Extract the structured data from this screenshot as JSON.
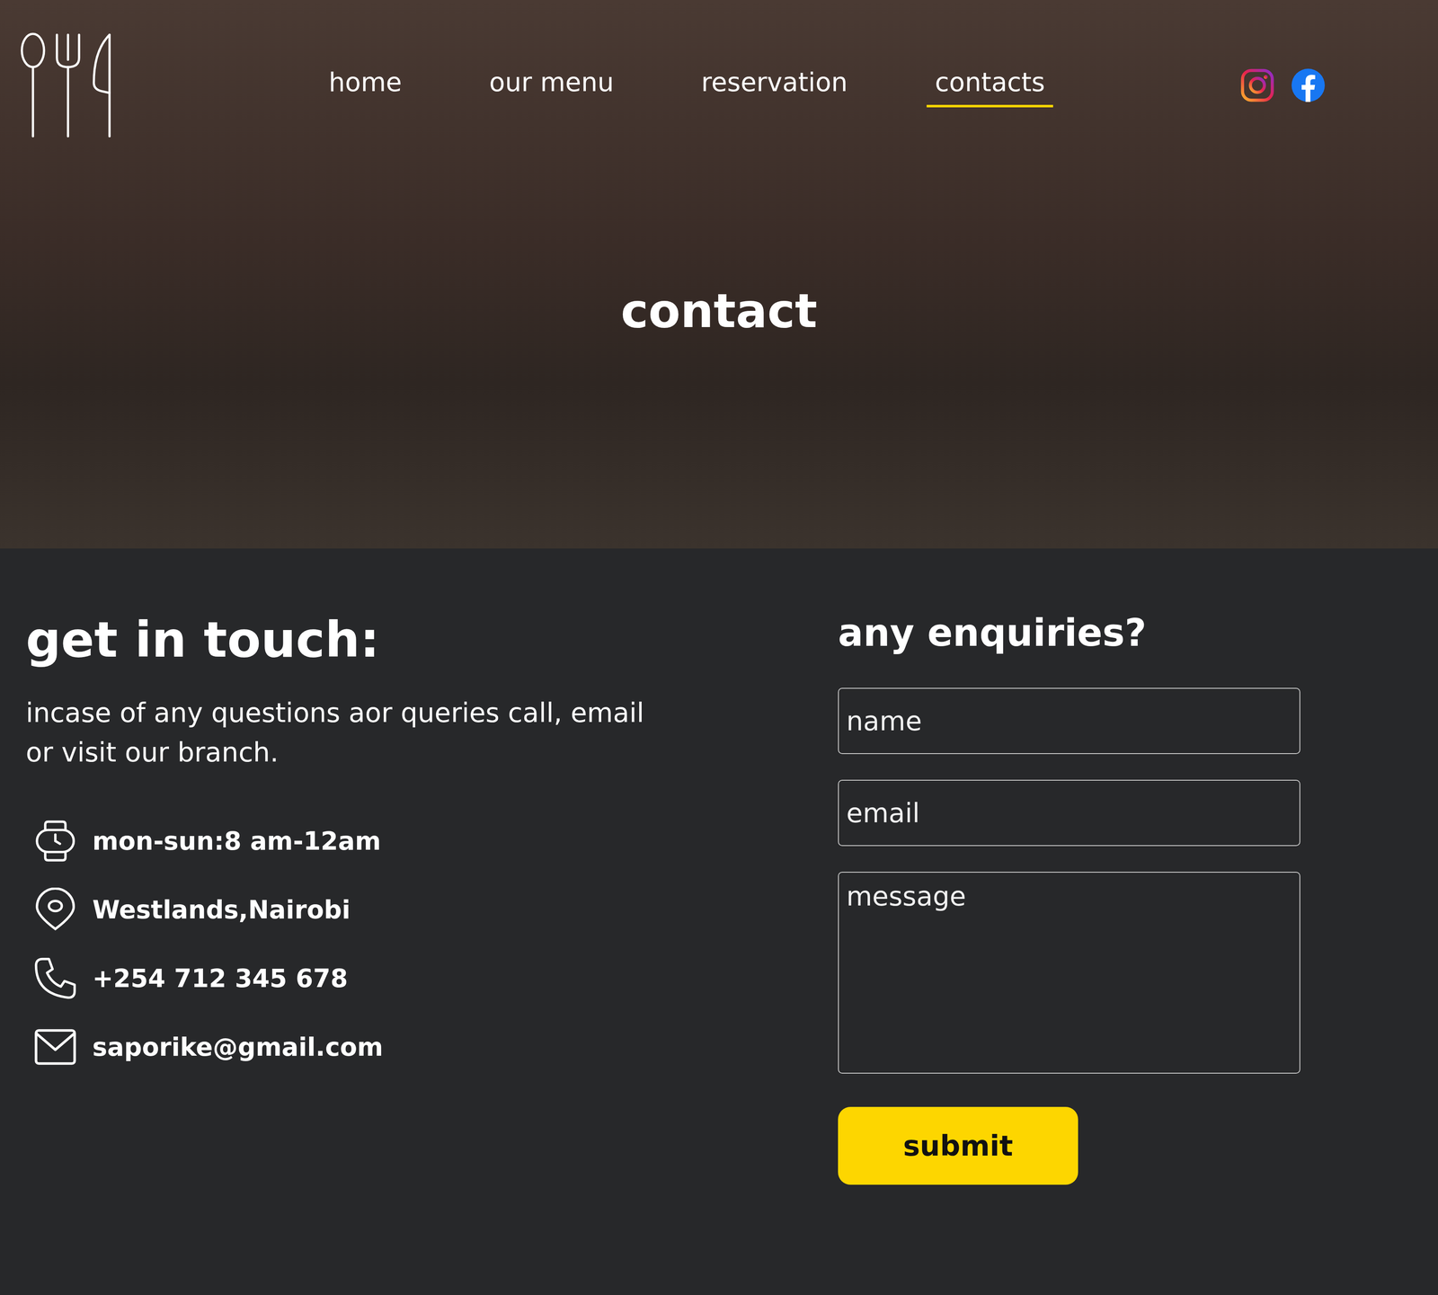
{
  "nav": {
    "links": [
      {
        "label": "home",
        "selected": false
      },
      {
        "label": "our menu",
        "selected": false
      },
      {
        "label": "reservation",
        "selected": false
      },
      {
        "label": "contacts",
        "selected": true
      }
    ]
  },
  "hero": {
    "title": "contact"
  },
  "contact": {
    "title": "get in touch:",
    "description": "incase of any questions aor queries call, email or visit our branch.",
    "items": [
      {
        "kind": "hours",
        "text": "mon-sun:8 am-12am"
      },
      {
        "kind": "location",
        "text": "Westlands,Nairobi"
      },
      {
        "kind": "phone",
        "text": "+254 712 345 678"
      },
      {
        "kind": "email",
        "text": "saporike@gmail.com"
      }
    ]
  },
  "form": {
    "title": "any enquiries?",
    "fields": [
      {
        "kind": "input",
        "placeholder": "name"
      },
      {
        "kind": "input",
        "placeholder": "email"
      },
      {
        "kind": "textarea",
        "placeholder": "message"
      }
    ],
    "button": "submit"
  }
}
